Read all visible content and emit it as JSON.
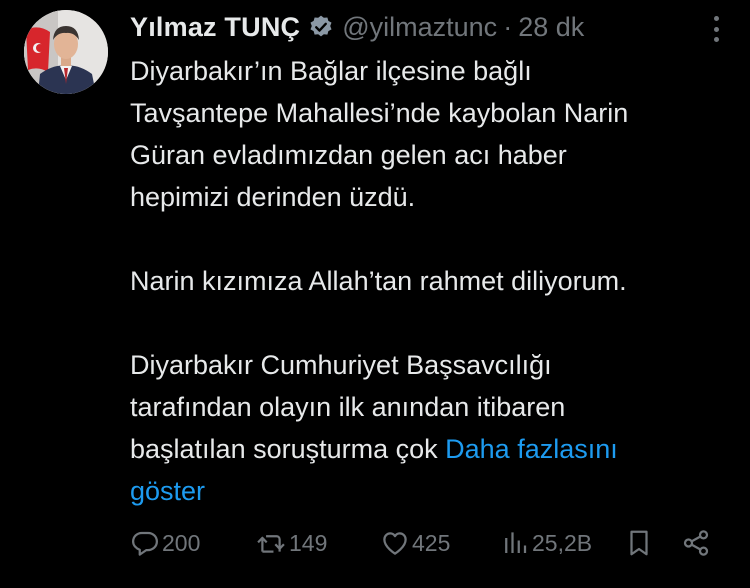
{
  "tweet": {
    "author_name": "Yılmaz TUNÇ",
    "handle": "@yilmaztunc",
    "separator": "·",
    "time": "28 dk",
    "paragraphs": [
      [
        "Diyarbakır’ın Bağlar ilçesine bağlı",
        "Tavşantepe Mahallesi’nde kaybolan Narin",
        "Güran evladımızdan gelen acı haber",
        "hepimizi derinden üzdü."
      ],
      [
        "Narin kızımıza Allah’tan rahmet diliyorum."
      ],
      [
        "Diyarbakır Cumhuriyet Başsavcılığı",
        "tarafından olayın ilk anından itibaren"
      ]
    ],
    "last_line_text": "başlatılan soruşturma çok",
    "show_more_1": "Daha fazlasını",
    "show_more_2": "göster"
  },
  "actions": {
    "reply_count": "200",
    "retweet_count": "149",
    "like_count": "425",
    "view_count": "25,2B"
  },
  "icons": {
    "verified": "verified-badge-icon",
    "more": "more-options-icon",
    "reply": "reply-icon",
    "retweet": "retweet-icon",
    "like": "heart-icon",
    "views": "views-chart-icon",
    "bookmark": "bookmark-icon",
    "share": "share-icon"
  },
  "colors": {
    "background": "#000000",
    "text": "#e7e9ea",
    "muted": "#71767b",
    "link": "#1d9bf0"
  }
}
